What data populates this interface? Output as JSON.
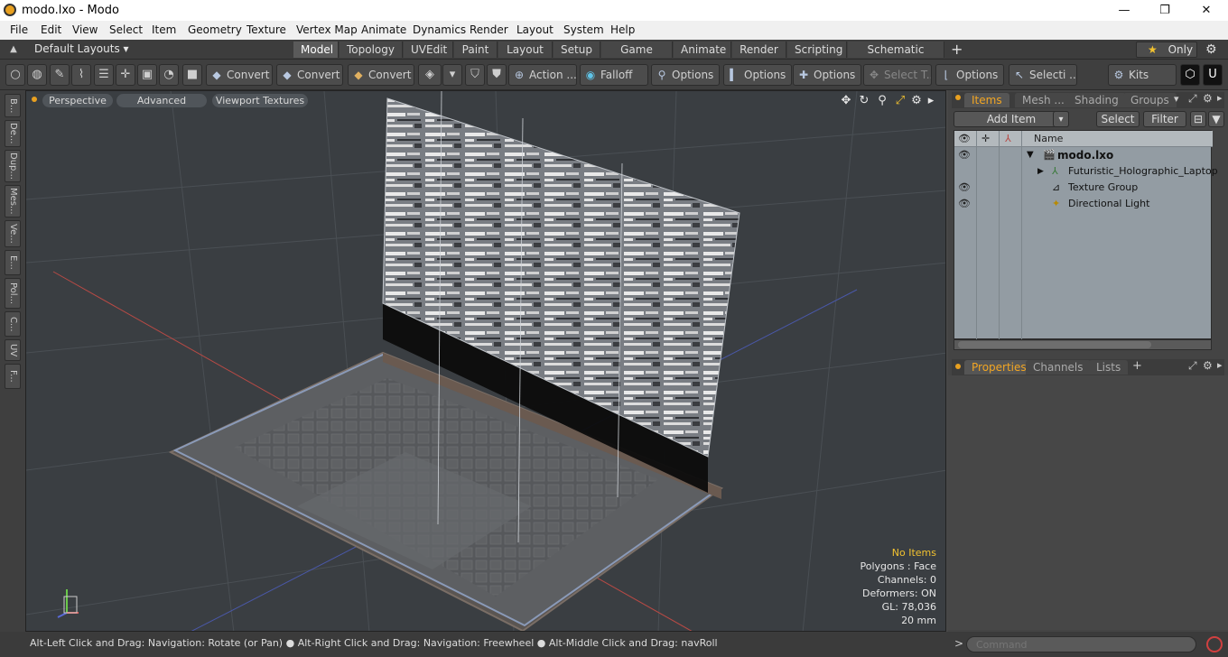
{
  "window": {
    "title": "modo.lxo - Modo",
    "minimize": "—",
    "maximize": "❐",
    "close": "✕"
  },
  "menu": [
    "File",
    "Edit",
    "View",
    "Select",
    "Item",
    "Geometry",
    "Texture",
    "Vertex Map",
    "Animate",
    "Dynamics",
    "Render",
    "Layout",
    "System",
    "Help"
  ],
  "layouts": {
    "label": "Default Layouts ▾",
    "tabs": [
      "Model",
      "Topology",
      "UVEdit",
      "Paint",
      "Layout",
      "Setup",
      "Game Tools",
      "Animate",
      "Render",
      "Scripting",
      "Schematic Fusion"
    ],
    "active": "Model",
    "add": "+",
    "only": "Only",
    "star": "★"
  },
  "toolbar": {
    "convert1": "Convert",
    "convert2": "Convert",
    "convert3": "Convert",
    "action": "Action  ...",
    "falloff": "Falloff",
    "options1": "Options",
    "options2": "Options",
    "options3": "Options",
    "select_t": "Select T...",
    "options4": "Options",
    "selecti": "Selecti ...",
    "kits": "Kits"
  },
  "left_tabs": [
    "B...",
    "De...",
    "Dup...",
    "Mes...",
    "Ve...",
    "E...",
    "Pol...",
    "C...",
    "UV",
    "F..."
  ],
  "viewport": {
    "mode": "Perspective",
    "advanced": "Advanced",
    "textures": "Viewport Textures",
    "info": {
      "selection": "No Items",
      "polygons": "Polygons : Face",
      "channels": "Channels: 0",
      "deformers": "Deformers: ON",
      "gl": "GL: 78,036",
      "unit": "20 mm"
    }
  },
  "status": "Alt-Left Click and Drag: Navigation: Rotate (or Pan) ● Alt-Right Click and Drag: Navigation: Freewheel ● Alt-Middle Click and Drag: navRoll",
  "items_panel": {
    "tabs": [
      "Items",
      "Mesh ...",
      "Shading",
      "Groups"
    ],
    "active": "Items",
    "add_item": "Add Item",
    "select": "Select",
    "filter": "Filter",
    "name_header": "Name",
    "rows": [
      {
        "name": "modo.lxo",
        "bold": true
      },
      {
        "name": "Futuristic_Holographic_Laptop"
      },
      {
        "name": "Texture Group"
      },
      {
        "name": "Directional Light"
      }
    ]
  },
  "props_panel": {
    "tabs": [
      "Properties",
      "Channels",
      "Lists"
    ],
    "active": "Properties",
    "add": "+"
  },
  "command": {
    "prompt": ">",
    "placeholder": "Command"
  },
  "colors": {
    "accent": "#f2a623",
    "viewport_bg": "#3a3e42",
    "list_bg": "#939ca3"
  }
}
